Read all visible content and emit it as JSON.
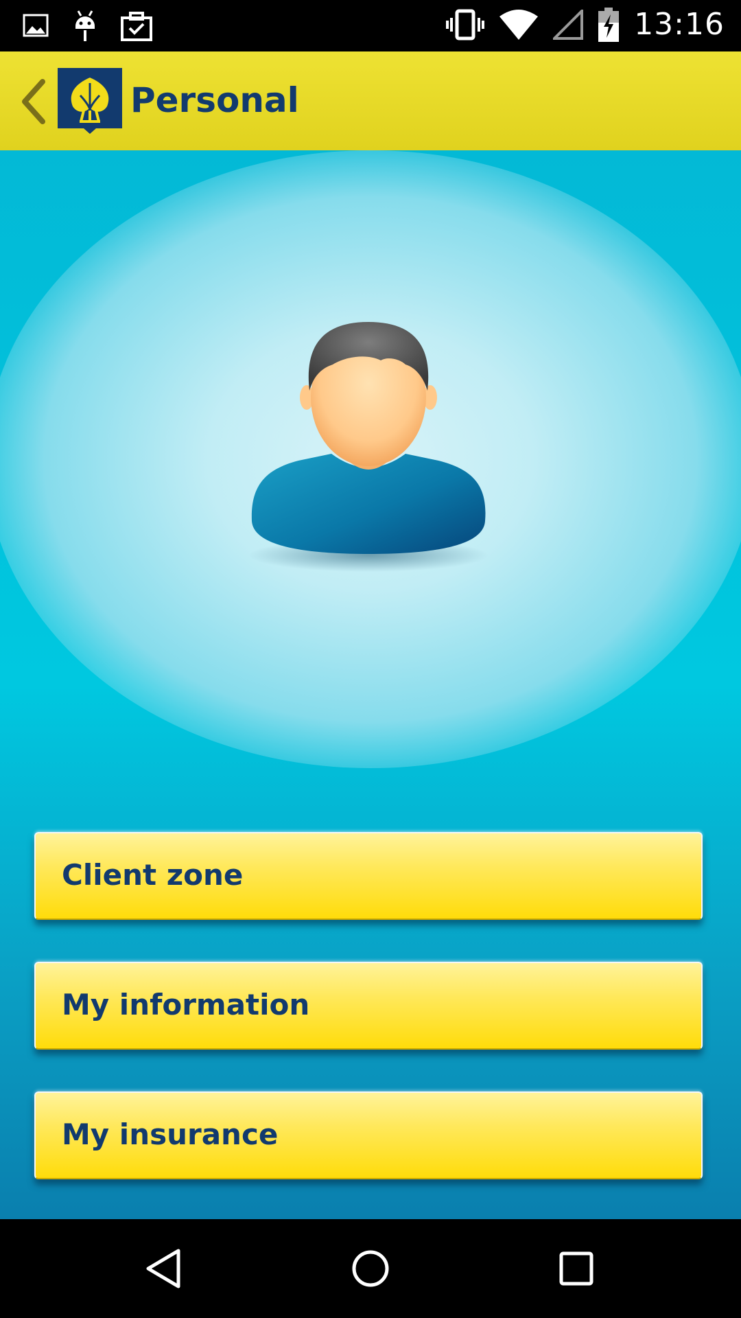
{
  "status_bar": {
    "time": "13:16",
    "left_icons": [
      "image-notification-icon",
      "android-debug-icon",
      "clipboard-check-icon"
    ],
    "right_icons": [
      "vibrate-icon",
      "wifi-icon",
      "cell-signal-icon",
      "battery-charging-icon"
    ]
  },
  "app_bar": {
    "title": "Personal",
    "back_icon": "chevron-left-icon",
    "logo_icon": "leaf-shield-logo",
    "color": "#e6d926",
    "title_color": "#123a6e"
  },
  "main": {
    "avatar_icon": "user-avatar-icon",
    "background_color": "#00c8e0",
    "buttons": [
      {
        "label": "Client zone"
      },
      {
        "label": "My information"
      },
      {
        "label": "My insurance"
      }
    ],
    "button_color": "#ffe22a"
  },
  "nav_bar": {
    "icons": [
      "nav-back-icon",
      "nav-home-icon",
      "nav-recents-icon"
    ]
  }
}
